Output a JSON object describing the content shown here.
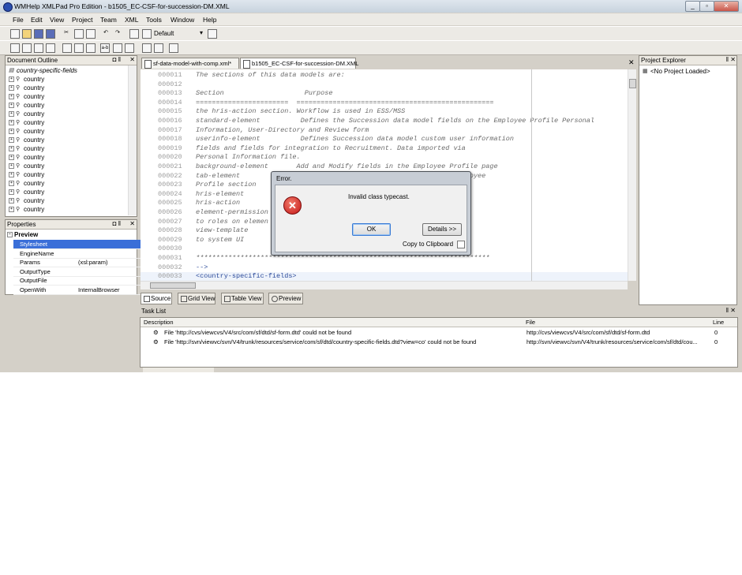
{
  "app": {
    "title": "WMHelp XMLPad Pro Edition - b1505_EC-CSF-for-succession-DM.XML",
    "window_buttons": [
      "_",
      "▫",
      "✕"
    ]
  },
  "menu": [
    "File",
    "Edit",
    "View",
    "Project",
    "Team",
    "XML",
    "Tools",
    "Window",
    "Help"
  ],
  "toolbar": {
    "profile_value": "Default"
  },
  "outline": {
    "title": "Document Outline",
    "root": "country-specific-fields",
    "items": [
      "country",
      "country",
      "country",
      "country",
      "country",
      "country",
      "country",
      "country",
      "country",
      "country",
      "country",
      "country",
      "country",
      "country",
      "country",
      "country"
    ]
  },
  "properties": {
    "title": "Properties",
    "group": "Preview",
    "rows": [
      {
        "key": "Stylesheet",
        "value": ""
      },
      {
        "key": "EngineName",
        "value": ""
      },
      {
        "key": "Params",
        "value": "(xsl:param)"
      },
      {
        "key": "OutputType",
        "value": ""
      },
      {
        "key": "OutputFile",
        "value": ""
      },
      {
        "key": "OpenWith",
        "value": "InternalBrowser"
      }
    ]
  },
  "editor_tabs": [
    {
      "label": "sf-data-model-with-comp.xml*"
    },
    {
      "label": "b1505_EC-CSF-for-succession-DM.XML"
    }
  ],
  "editor": {
    "lines": [
      {
        "num": "000011",
        "text": "The sections of this data models are:"
      },
      {
        "num": "000012",
        "text": ""
      },
      {
        "num": "000013",
        "text": "Section                    Purpose"
      },
      {
        "num": "000014",
        "text": "=======================  ================================================="
      },
      {
        "num": "000015",
        "text": "the hris-action section. Workflow is used in ESS/MSS"
      },
      {
        "num": "000016",
        "text": "standard-element          Defines the Succession data model fields on the Employee Profile Personal"
      },
      {
        "num": "000017",
        "text": "Information, User-Directory and Review form"
      },
      {
        "num": "000018",
        "text": "userinfo-element          Defines Succession data model custom user information"
      },
      {
        "num": "000019",
        "text": "fields and fields for integration to Recruitment. Data imported via"
      },
      {
        "num": "000020",
        "text": "Personal Information file."
      },
      {
        "num": "000021",
        "text": "background-element       Add and Modify fields in the Employee Profile page"
      },
      {
        "num": "000022",
        "text": "tab-element                                                main Employee"
      },
      {
        "num": "000023",
        "text": "Profile section"
      },
      {
        "num": "000024",
        "text": "hris-element"
      },
      {
        "num": "000025",
        "text": "hris-action"
      },
      {
        "num": "000026",
        "text": "element-permission                                   e permissions"
      },
      {
        "num": "000027",
        "text": "to roles on elemen"
      },
      {
        "num": "000028",
        "text": "view-template                                          ts available"
      },
      {
        "num": "000029",
        "text": "to system UI"
      },
      {
        "num": "000030",
        "text": ""
      },
      {
        "num": "000031",
        "text": "*************************************************************************"
      },
      {
        "num": "000032",
        "text": "-->"
      },
      {
        "num": "000033",
        "text": "<country-specific-fields>"
      }
    ]
  },
  "view_tabs": [
    "Source",
    "Grid View",
    "Table View",
    "Preview"
  ],
  "project_explorer": {
    "title": "Project Explorer",
    "empty_label": "<No Project Loaded>"
  },
  "tasklist": {
    "title": "Task List",
    "columns": [
      "Description",
      "File",
      "Line"
    ],
    "rows": [
      {
        "desc": "File 'http://cvs/viewcvs/V4/src/com/sf/dtd/sf-form.dtd' could not be found",
        "file": "http://cvs/viewcvs/V4/src/com/sf/dtd/sf-form.dtd",
        "line": "0"
      },
      {
        "desc": "File 'http://svn/viewvc/svn/V4/trunk/resources/service/com/sf/dtd/country-specific-fields.dtd?view=co' could not be found",
        "file": "http://svn/viewvc/svn/V4/trunk/resources/service/com/sf/dtd/cou...",
        "line": "0"
      }
    ]
  },
  "dialog": {
    "title": "Error.",
    "message": "Invalid class typecast.",
    "ok_label": "OK",
    "details_label": "Details >>",
    "copy_label": "Copy to Clipboard"
  },
  "colors": {
    "error_red": "#d42020",
    "selection_blue": "#3a6fd8",
    "xml_blue": "#2a4a9a"
  }
}
